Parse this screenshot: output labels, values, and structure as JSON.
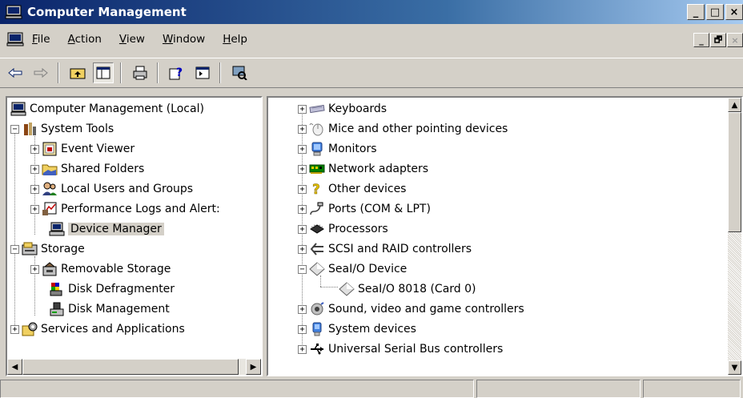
{
  "window": {
    "title": "Computer Management",
    "controls": [
      "_",
      "□",
      "×"
    ]
  },
  "menubar": {
    "items": [
      {
        "label": "File",
        "accel": "F",
        "rest": "ile"
      },
      {
        "label": "Action",
        "accel": "A",
        "rest": "ction"
      },
      {
        "label": "View",
        "accel": "V",
        "rest": "iew"
      },
      {
        "label": "Window",
        "accel": "W",
        "rest": "indow"
      },
      {
        "label": "Help",
        "accel": "H",
        "rest": "elp"
      }
    ],
    "mdi_controls": [
      "_",
      "🗗",
      "×"
    ]
  },
  "toolbar": {
    "buttons": [
      "back-icon",
      "forward-icon",
      "up-folder-icon",
      "show-hide-tree-icon",
      "print-icon",
      "help-icon",
      "properties-icon",
      "scan-hardware-icon"
    ]
  },
  "left_tree": {
    "root": "Computer Management (Local)",
    "system_tools": "System Tools",
    "event_viewer": "Event Viewer",
    "shared_folders": "Shared Folders",
    "local_users": "Local Users and Groups",
    "perf_logs": "Performance Logs and Alert:",
    "device_manager": "Device Manager",
    "storage": "Storage",
    "removable_storage": "Removable Storage",
    "disk_defrag": "Disk Defragmenter",
    "disk_mgmt": "Disk Management",
    "services": "Services and Applications"
  },
  "right_tree": {
    "keyboards": "Keyboards",
    "mice": "Mice and other pointing devices",
    "monitors": "Monitors",
    "network": "Network adapters",
    "other": "Other devices",
    "ports": "Ports (COM & LPT)",
    "processors": "Processors",
    "scsi": "SCSI and RAID controllers",
    "sealio": "SeaI/O Device",
    "sealio_card": "SeaI/O 8018 (Card 0)",
    "sound": "Sound, video and game controllers",
    "system": "System devices",
    "usb": "Universal Serial Bus controllers"
  },
  "colors": {
    "title_gradient_start": "#0a246a",
    "title_gradient_end": "#a6caf0",
    "face": "#d4d0c8"
  }
}
